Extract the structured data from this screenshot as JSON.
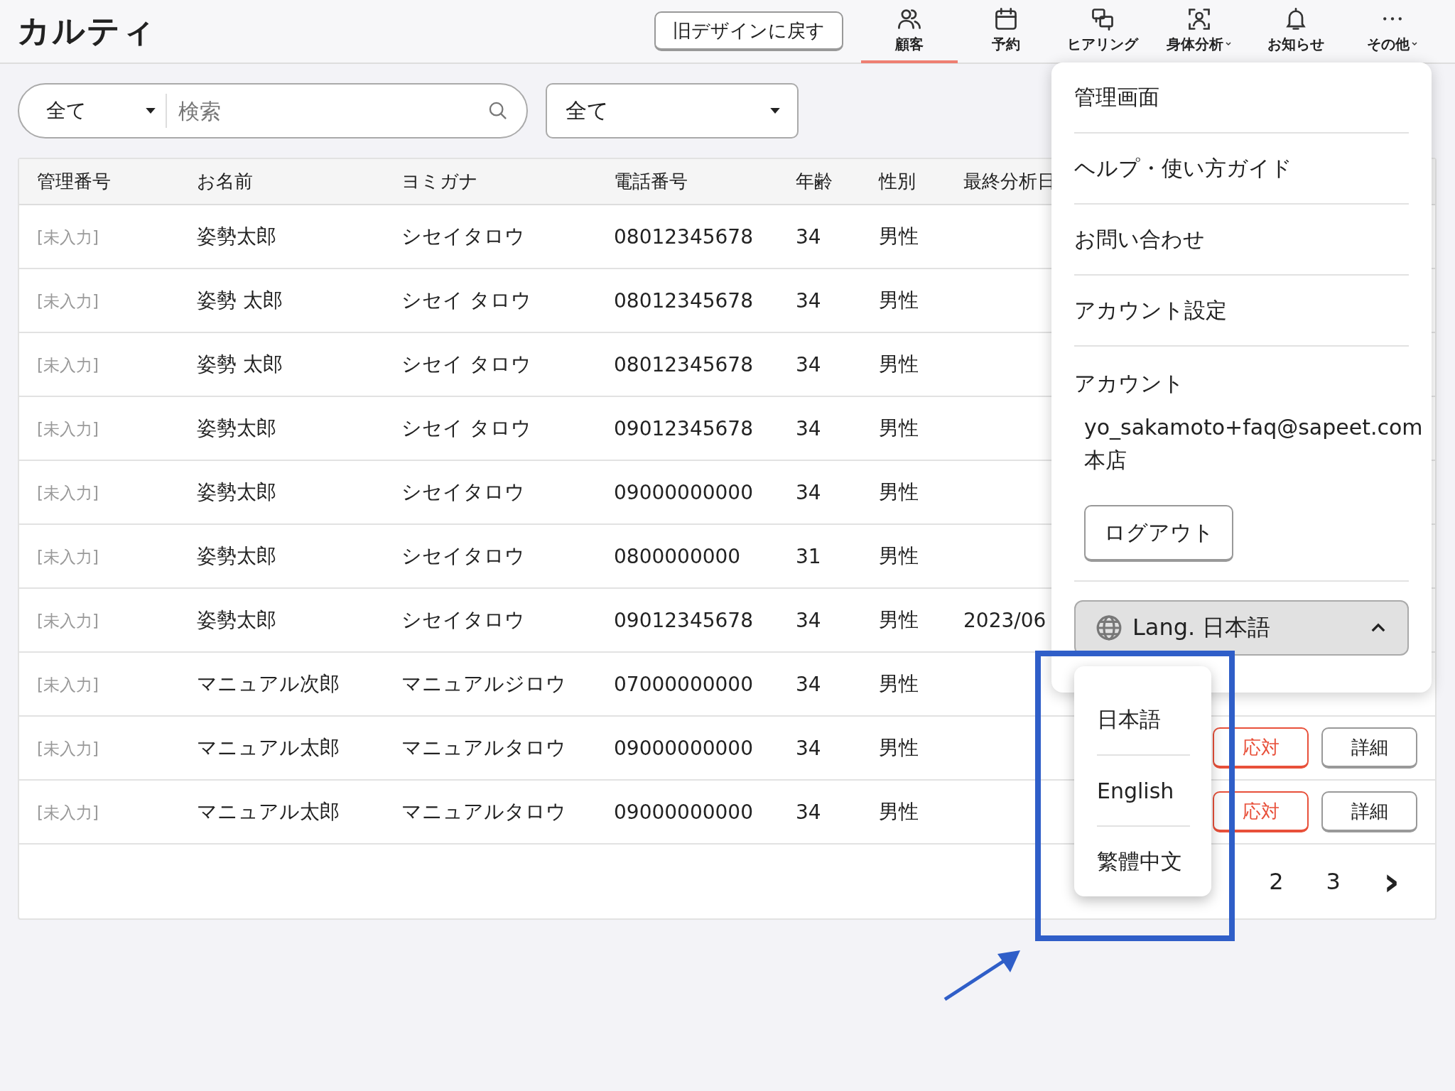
{
  "header": {
    "logo": "カルティ",
    "old_design_button": "旧デザインに戻す",
    "nav": [
      {
        "label": "顧客",
        "selected": true,
        "has_menu": false
      },
      {
        "label": "予約",
        "selected": false,
        "has_menu": false
      },
      {
        "label": "ヒアリング",
        "selected": false,
        "has_menu": false
      },
      {
        "label": "身体分析",
        "selected": false,
        "has_menu": true
      },
      {
        "label": "お知らせ",
        "selected": false,
        "has_menu": false
      },
      {
        "label": "その他",
        "selected": false,
        "has_menu": true
      }
    ]
  },
  "search": {
    "scope": "全て",
    "placeholder": "検索"
  },
  "filter": {
    "value": "全て"
  },
  "table": {
    "columns": [
      "管理番号",
      "お名前",
      "ヨミガナ",
      "電話番号",
      "年齢",
      "性別",
      "最終分析日"
    ],
    "rows": [
      {
        "cells": [
          "[未入力]",
          "姿勢太郎",
          "シセイタロウ",
          "08012345678",
          "34",
          "男性",
          ""
        ],
        "actions": []
      },
      {
        "cells": [
          "[未入力]",
          "姿勢 太郎",
          "シセイ タロウ",
          "08012345678",
          "34",
          "男性",
          ""
        ],
        "actions": []
      },
      {
        "cells": [
          "[未入力]",
          "姿勢 太郎",
          "シセイ タロウ",
          "08012345678",
          "34",
          "男性",
          ""
        ],
        "actions": []
      },
      {
        "cells": [
          "[未入力]",
          "姿勢太郎",
          "シセイ タロウ",
          "09012345678",
          "34",
          "男性",
          ""
        ],
        "actions": []
      },
      {
        "cells": [
          "[未入力]",
          "姿勢太郎",
          "シセイタロウ",
          "09000000000",
          "34",
          "男性",
          ""
        ],
        "actions": []
      },
      {
        "cells": [
          "[未入力]",
          "姿勢太郎",
          "シセイタロウ",
          "0800000000",
          "31",
          "男性",
          ""
        ],
        "actions": []
      },
      {
        "cells": [
          "[未入力]",
          "姿勢太郎",
          "シセイタロウ",
          "09012345678",
          "34",
          "男性",
          "2023/06"
        ],
        "actions": []
      },
      {
        "cells": [
          "[未入力]",
          "マニュアル次郎",
          "マニュアルジロウ",
          "07000000000",
          "34",
          "男性",
          ""
        ],
        "actions": []
      },
      {
        "cells": [
          "[未入力]",
          "マニュアル太郎",
          "マニュアルタロウ",
          "09000000000",
          "34",
          "男性",
          ""
        ],
        "actions": [
          {
            "label": "応対",
            "kind": "primary"
          },
          {
            "label": "詳細",
            "kind": "secondary"
          }
        ]
      },
      {
        "cells": [
          "[未入力]",
          "マニュアル太郎",
          "マニュアルタロウ",
          "09000000000",
          "34",
          "男性",
          ""
        ],
        "actions": [
          {
            "label": "応対",
            "kind": "primary"
          },
          {
            "label": "詳細",
            "kind": "secondary"
          }
        ]
      }
    ],
    "pagination": {
      "pages": [
        "2",
        "3"
      ],
      "next": "›"
    }
  },
  "menu": {
    "items": [
      "管理画面",
      "ヘルプ・使い方ガイド",
      "お問い合わせ",
      "アカウント設定"
    ],
    "account": {
      "heading": "アカウント",
      "email": "yo_sakamoto+faq@sapeet.com",
      "store": "本店",
      "logout": "ログアウト"
    },
    "language": {
      "label": "Lang. 日本語",
      "expanded": true,
      "options": [
        "日本語",
        "English",
        "繁體中文"
      ]
    }
  }
}
